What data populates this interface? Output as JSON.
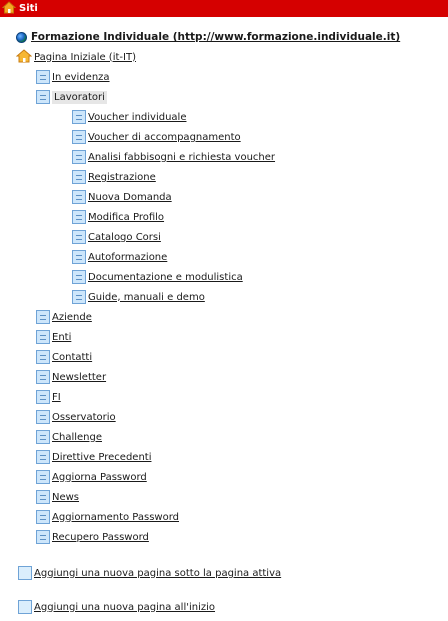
{
  "header": {
    "title": "Siti",
    "icon": "home-icon"
  },
  "site": {
    "label": "Formazione Individuale (http://www.formazione.individuale.it)",
    "icon": "globe-icon"
  },
  "home": {
    "label": "Pagina Iniziale (it-IT)",
    "icon": "home-icon"
  },
  "pages": {
    "in_evidenza": "In evidenza",
    "lavoratori": "Lavoratori",
    "voucher_individuale": "Voucher individuale",
    "voucher_accompagnamento": "Voucher di accompagnamento",
    "analisi": "Analisi fabbisogni e richiesta voucher",
    "registrazione": "Registrazione",
    "nuova_domanda": "Nuova Domanda",
    "modifica_profilo": "Modifica Profilo",
    "catalogo_corsi": "Catalogo Corsi",
    "autoformazione": "Autoformazione",
    "documentazione": "Documentazione e modulistica",
    "guide": "Guide, manuali e demo",
    "aziende": "Aziende",
    "enti": "Enti",
    "contatti": "Contatti",
    "newsletter": "Newsletter",
    "fi": "FI",
    "osservatorio": "Osservatorio",
    "challenge": "Challenge",
    "direttive": "Direttive Precedenti",
    "aggiorna_password": "Aggiorna Password",
    "news": "News",
    "aggiornamento_password": "Aggiornamento Password",
    "recupero_password": "Recupero Password"
  },
  "actions": {
    "add_below": "Aggiungi una nuova pagina sotto la pagina attiva",
    "add_start": "Aggiungi una nuova pagina all'inizio"
  },
  "colors": {
    "header_bg": "#d50000",
    "header_text": "#ffffff",
    "active_bg": "#e6e6e6"
  }
}
